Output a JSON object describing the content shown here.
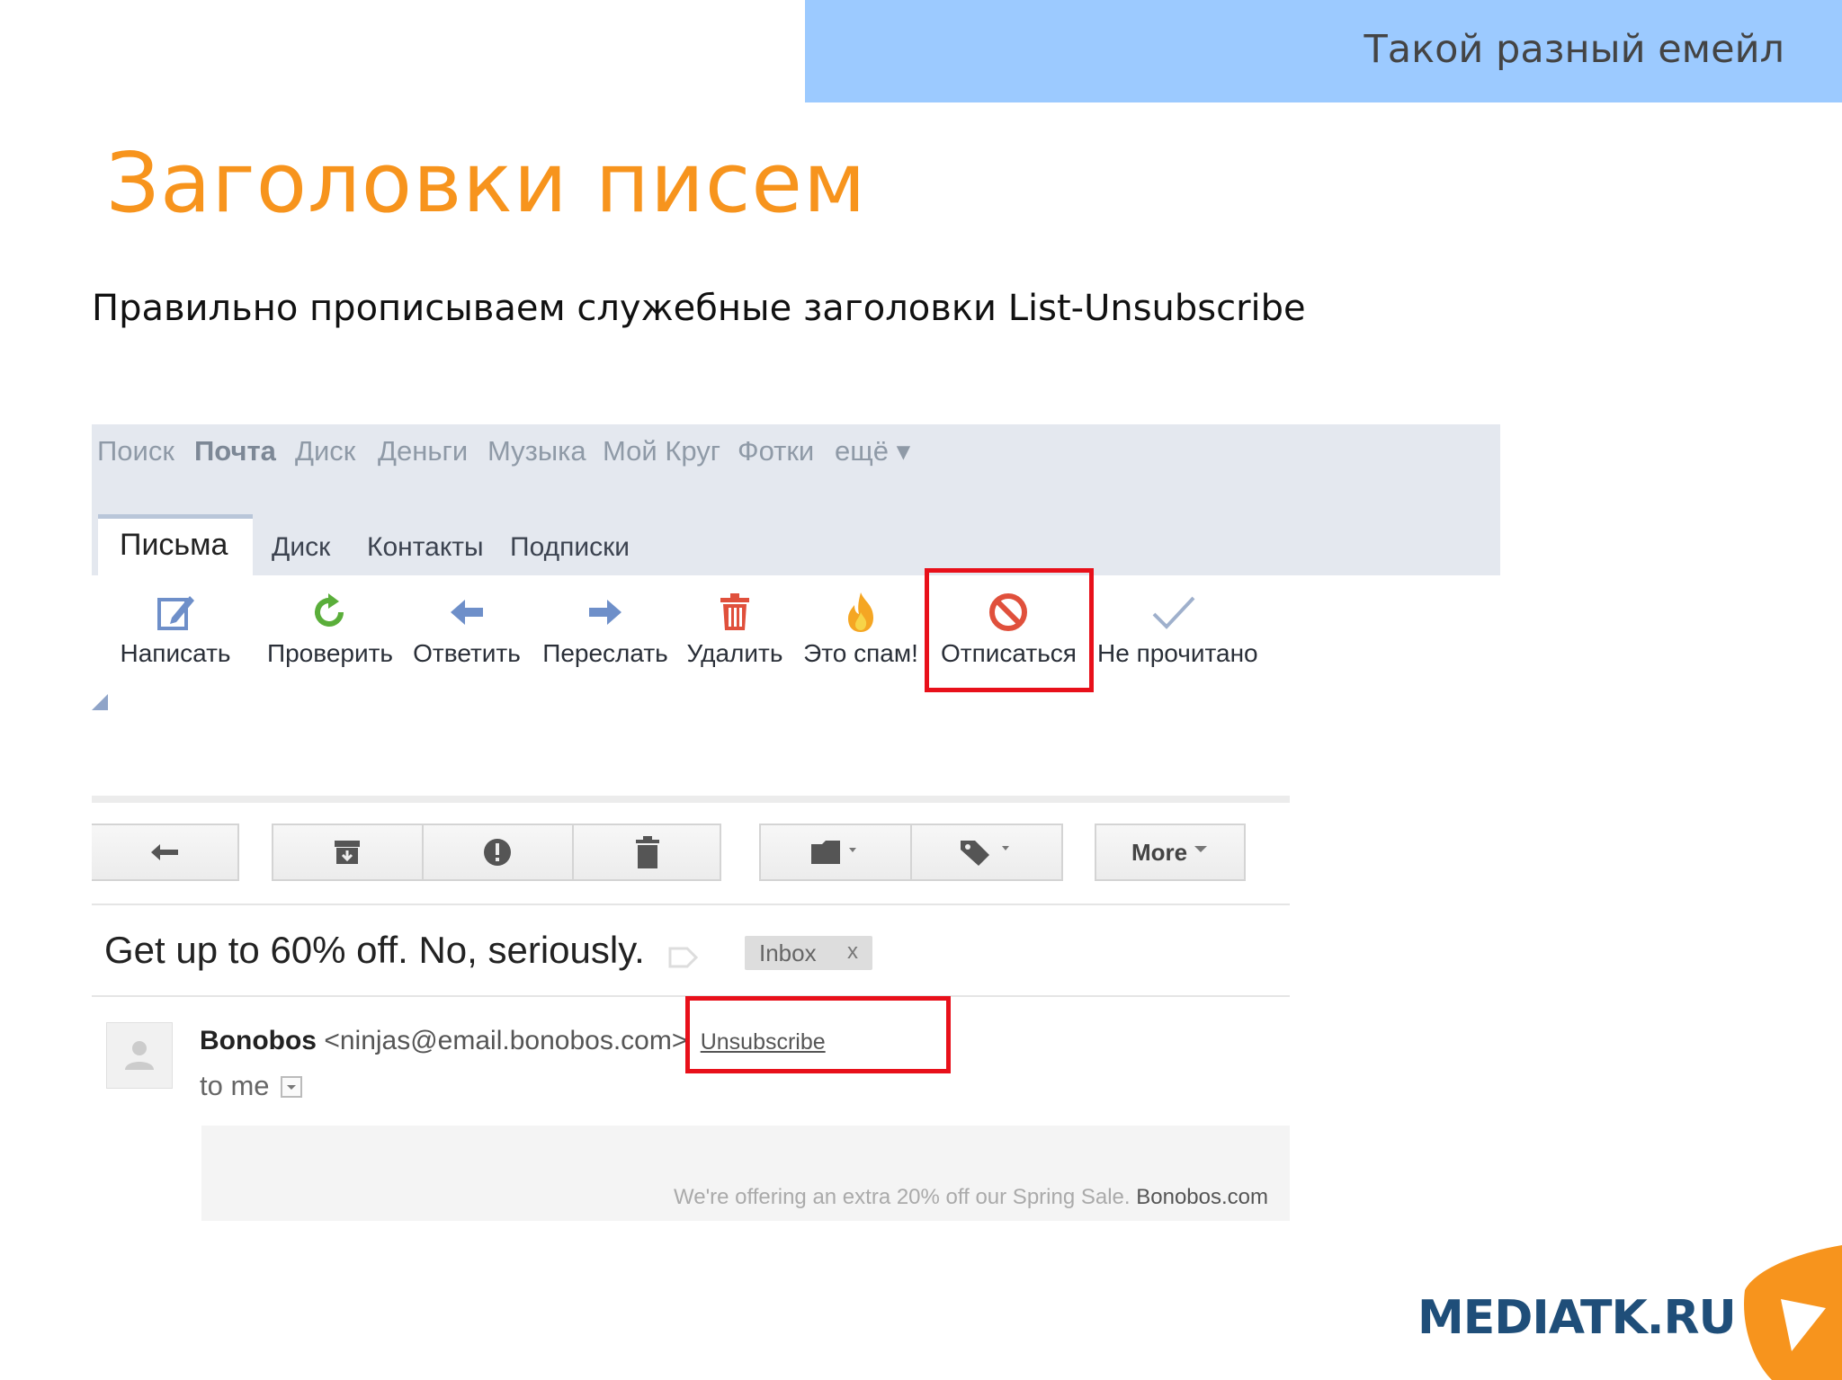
{
  "slide": {
    "banner": "Такой разный емейл",
    "title": "Заголовки писем",
    "subtitle": "Правильно прописываем служебные заголовки List-Unsubscribe"
  },
  "yandex": {
    "topnav": [
      "Поиск",
      "Почта",
      "Диск",
      "Деньги",
      "Музыка",
      "Мой Круг",
      "Фотки",
      "ещё ▾"
    ],
    "tabs": {
      "active": "Письма",
      "others": [
        "Диск",
        "Контакты",
        "Подписки"
      ]
    },
    "toolbar": [
      {
        "label": "Написать",
        "icon": "compose-icon"
      },
      {
        "label": "Проверить",
        "icon": "refresh-icon"
      },
      {
        "label": "Ответить",
        "icon": "reply-arrow-icon"
      },
      {
        "label": "Переслать",
        "icon": "forward-arrow-icon"
      },
      {
        "label": "Удалить",
        "icon": "trash-icon"
      },
      {
        "label": "Это спам!",
        "icon": "fire-icon"
      },
      {
        "label": "Отписаться",
        "icon": "no-entry-icon"
      },
      {
        "label": "Не прочитано",
        "icon": "checkmark-icon"
      }
    ],
    "colors": {
      "highlight": "#e8101a",
      "refresh": "#5aae3a",
      "arrow": "#6e8fc9",
      "trash": "#e0503c",
      "fire": "#f5a623",
      "no_entry": "#e0503c",
      "check": "#9fb0cc"
    }
  },
  "gmail": {
    "more_label": "More",
    "subject": "Get up to 60% off. No, seriously.",
    "inbox_label": "Inbox",
    "inbox_close": "x",
    "sender_name": "Bonobos",
    "sender_email": "<ninjas@email.bonobos.com>",
    "unsubscribe": "Unsubscribe",
    "recipient": "to me",
    "preview": "We're offering an extra 20% off our Spring Sale.",
    "preview_site": "Bonobos.com"
  },
  "logo": {
    "text": "MEDIATK.RU",
    "colors": {
      "text": "#1f4e79",
      "mark": "#f7941d"
    }
  }
}
